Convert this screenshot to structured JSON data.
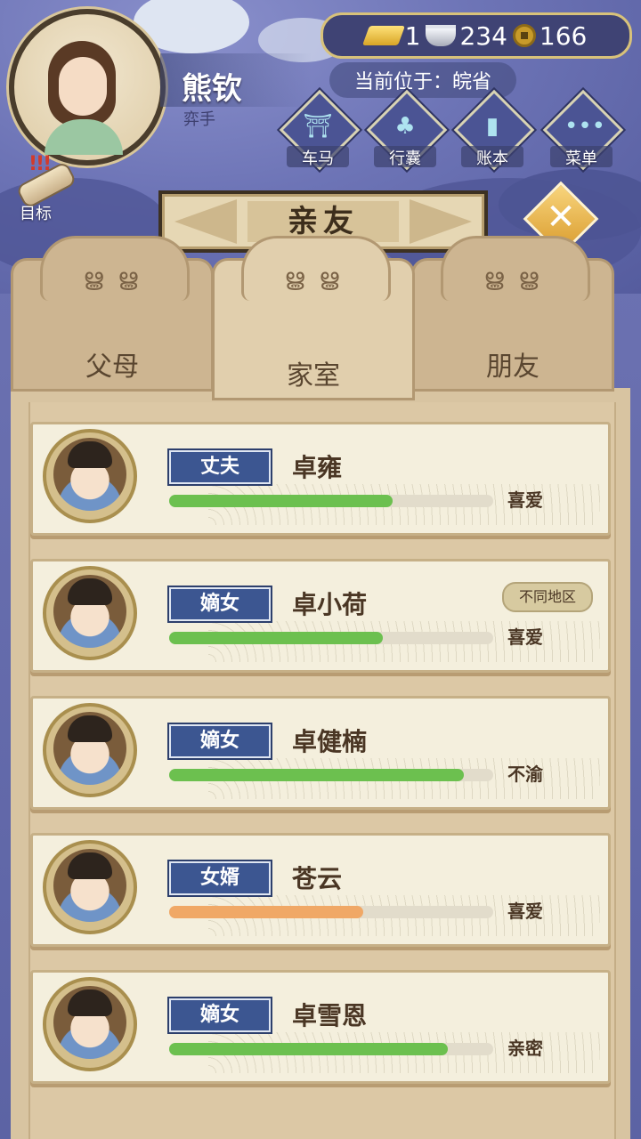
{
  "player": {
    "name": "熊钦",
    "rank": "弈手"
  },
  "currency": {
    "gold": "1",
    "silver": "234",
    "copper": "166"
  },
  "location": "当前位于：皖省",
  "menu": [
    {
      "label": "车马",
      "icon": "carriage-icon"
    },
    {
      "label": "行囊",
      "icon": "bundle-icon"
    },
    {
      "label": "账本",
      "icon": "ledger-icon"
    },
    {
      "label": "菜单",
      "icon": "more-icon"
    }
  ],
  "target_label": "目标",
  "title": "亲友",
  "tabs": [
    {
      "label": "父母",
      "active": false
    },
    {
      "label": "家室",
      "active": true
    },
    {
      "label": "朋友",
      "active": false
    }
  ],
  "relatives": [
    {
      "role": "丈夫",
      "name": "卓雍",
      "relation": "喜爱",
      "affection": 0.69,
      "bar_color": "#6cc04f",
      "region": ""
    },
    {
      "role": "嫡女",
      "name": "卓小荷",
      "relation": "喜爱",
      "affection": 0.66,
      "bar_color": "#6cc04f",
      "region": "不同地区"
    },
    {
      "role": "嫡女",
      "name": "卓健楠",
      "relation": "不渝",
      "affection": 0.91,
      "bar_color": "#6cc04f",
      "region": ""
    },
    {
      "role": "女婿",
      "name": "苍云",
      "relation": "喜爱",
      "affection": 0.6,
      "bar_color": "#f0a866",
      "region": ""
    },
    {
      "role": "嫡女",
      "name": "卓雪恩",
      "relation": "亲密",
      "affection": 0.86,
      "bar_color": "#6cc04f",
      "region": ""
    }
  ]
}
